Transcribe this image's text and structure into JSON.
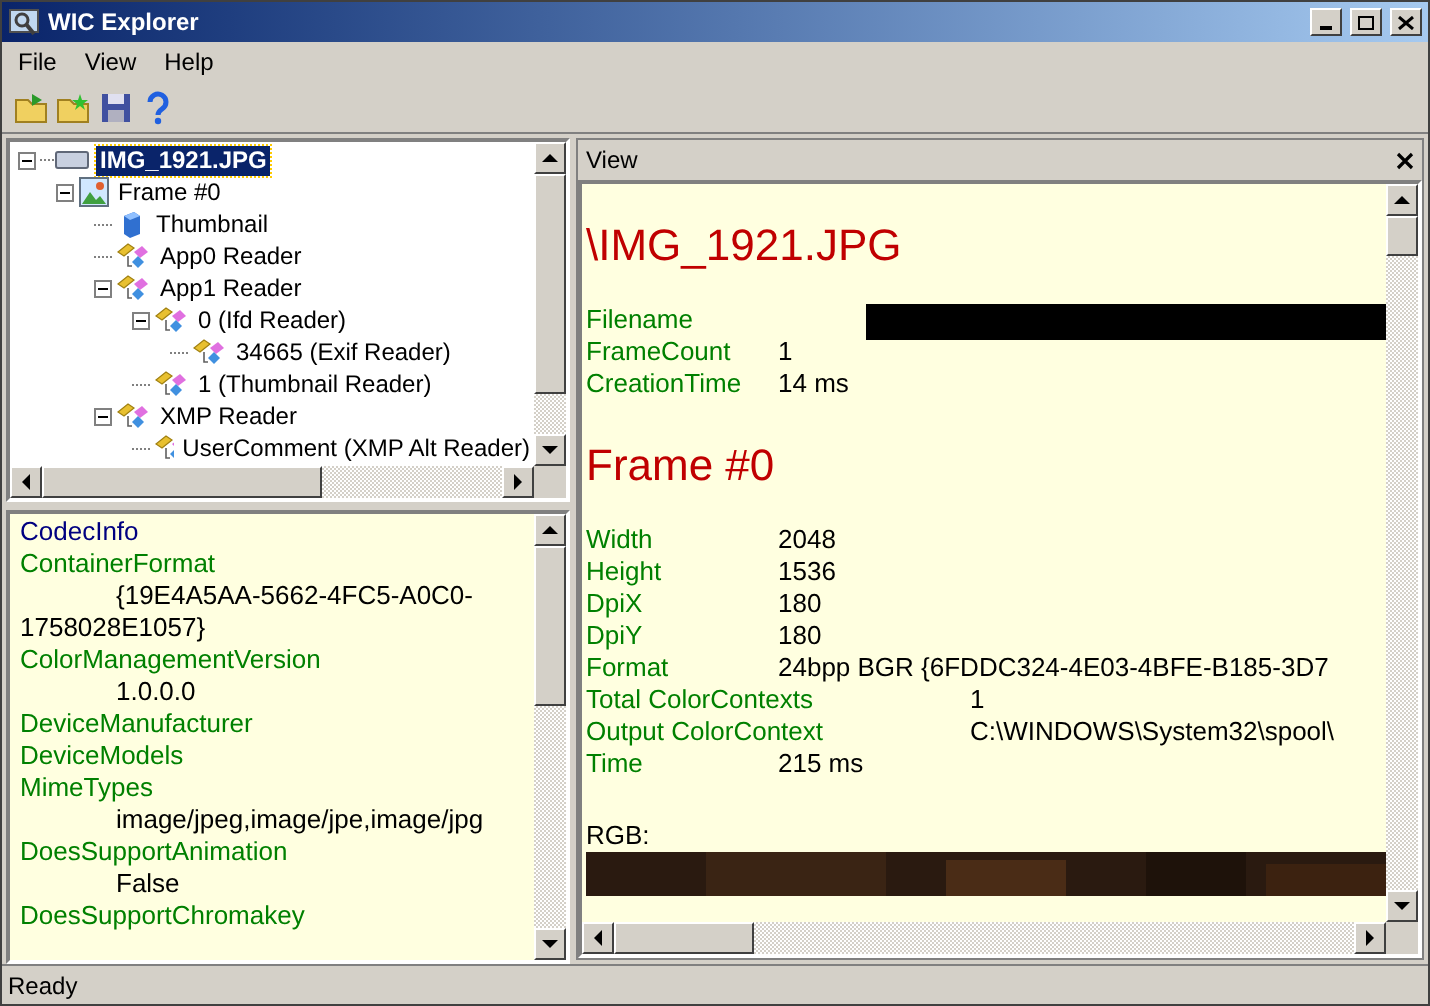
{
  "window": {
    "title": "WIC Explorer"
  },
  "menu": [
    "File",
    "View",
    "Help"
  ],
  "toolbar": [
    {
      "kind": "open"
    },
    {
      "kind": "new"
    },
    {
      "kind": "save"
    },
    {
      "kind": "help"
    }
  ],
  "tree": [
    {
      "label": "IMG_1921.JPG",
      "kind": "file",
      "selected": true,
      "expanded": true,
      "children": [
        {
          "label": "Frame #0",
          "kind": "frame",
          "selected": false,
          "expanded": true,
          "children": [
            {
              "label": "Thumbnail",
              "kind": "thumbnail",
              "selected": false
            },
            {
              "label": "App0 Reader",
              "kind": "reader",
              "selected": false
            },
            {
              "label": "App1 Reader",
              "kind": "reader",
              "selected": false,
              "expanded": true,
              "children": [
                {
                  "label": "0 (Ifd Reader)",
                  "kind": "reader",
                  "selected": false,
                  "expanded": true,
                  "children": [
                    {
                      "label": "34665 (Exif Reader)",
                      "kind": "reader",
                      "selected": false
                    }
                  ]
                },
                {
                  "label": "1 (Thumbnail Reader)",
                  "kind": "reader",
                  "selected": false
                }
              ]
            },
            {
              "label": "XMP Reader",
              "kind": "reader",
              "selected": false,
              "expanded": true,
              "children": [
                {
                  "label": "UserComment (XMP Alt Reader)",
                  "kind": "reader",
                  "selected": false
                }
              ]
            }
          ]
        }
      ]
    }
  ],
  "properties": [
    {
      "kind": "category",
      "text": "CodecInfo"
    },
    {
      "kind": "name",
      "text": "ContainerFormat"
    },
    {
      "kind": "value",
      "text": "{19E4A5AA-5662-4FC5-A0C0-1758028E1057}"
    },
    {
      "kind": "name",
      "text": "ColorManagementVersion"
    },
    {
      "kind": "value",
      "text": "1.0.0.0"
    },
    {
      "kind": "name",
      "text": "DeviceManufacturer"
    },
    {
      "kind": "name",
      "text": "DeviceModels"
    },
    {
      "kind": "name",
      "text": "MimeTypes"
    },
    {
      "kind": "value",
      "text": "image/jpeg,image/jpe,image/jpg"
    },
    {
      "kind": "name",
      "text": "DoesSupportAnimation"
    },
    {
      "kind": "value",
      "text": "False"
    },
    {
      "kind": "name",
      "text": "DoesSupportChromakey"
    }
  ],
  "view": {
    "title": "View",
    "sections": [
      {
        "heading": "\\IMG_1921.JPG",
        "rows": [
          {
            "name": "Filename",
            "kind": "redacted"
          },
          {
            "name": "FrameCount",
            "value": "1",
            "kind": "short"
          },
          {
            "name": "CreationTime",
            "value": "14 ms",
            "kind": "short"
          }
        ]
      },
      {
        "heading": "Frame #0",
        "rows": [
          {
            "name": "Width",
            "value": "2048",
            "kind": "short"
          },
          {
            "name": "Height",
            "value": "1536",
            "kind": "short"
          },
          {
            "name": "DpiX",
            "value": "180",
            "kind": "short"
          },
          {
            "name": "DpiY",
            "value": "180",
            "kind": "short"
          },
          {
            "name": "Format",
            "value": "24bpp BGR {6FDDC324-4E03-4BFE-B185-3D7",
            "kind": "short"
          },
          {
            "name": "Total ColorContexts",
            "value": "1",
            "kind": "wide"
          },
          {
            "name": "Output ColorContext",
            "value": "C:\\WINDOWS\\System32\\spool\\",
            "kind": "wide"
          },
          {
            "name": "Time",
            "value": "215 ms",
            "kind": "short"
          }
        ]
      }
    ],
    "image_label": "RGB:"
  },
  "status_bar": "Ready"
}
